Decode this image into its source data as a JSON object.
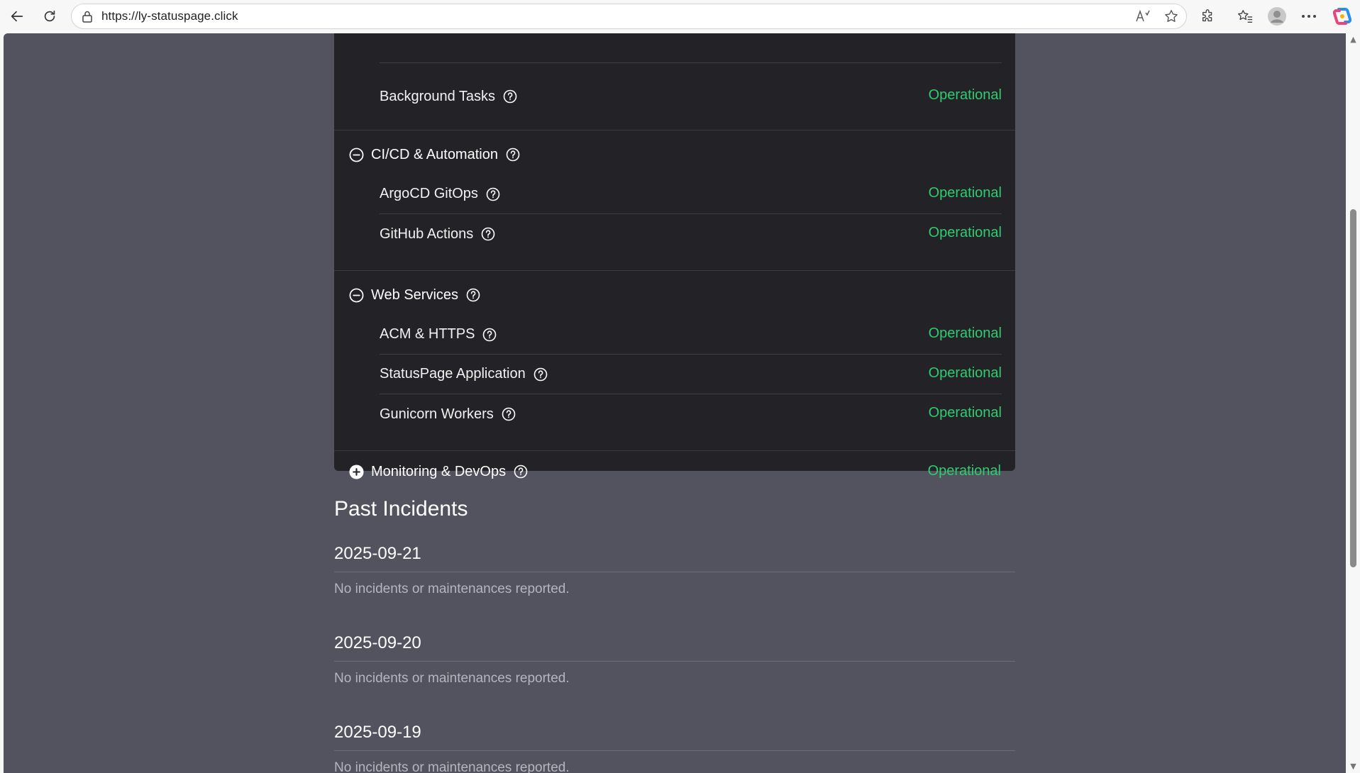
{
  "browser": {
    "url": "https://ly-statuspage.click",
    "icons": [
      "back-icon",
      "refresh-icon",
      "lock-icon",
      "read-aloud-icon",
      "favorite-star-icon",
      "extensions-icon",
      "favorites-icon",
      "profile-icon",
      "more-icon",
      "copilot-icon"
    ]
  },
  "groups": [
    {
      "name": "",
      "expanded": true,
      "components": [
        {
          "name": "Background Tasks",
          "status": "Operational"
        }
      ]
    },
    {
      "name": "CI/CD & Automation",
      "expanded": true,
      "components": [
        {
          "name": "ArgoCD GitOps",
          "status": "Operational"
        },
        {
          "name": "GitHub Actions",
          "status": "Operational"
        }
      ]
    },
    {
      "name": "Web Services",
      "expanded": true,
      "components": [
        {
          "name": "ACM & HTTPS",
          "status": "Operational"
        },
        {
          "name": "StatusPage Application",
          "status": "Operational"
        },
        {
          "name": "Gunicorn Workers",
          "status": "Operational"
        }
      ]
    },
    {
      "name": "Monitoring & DevOps",
      "expanded": false,
      "status": "Operational",
      "components": []
    }
  ],
  "past_incidents": {
    "title": "Past Incidents",
    "days": [
      {
        "date": "2025-09-21",
        "message": "No incidents or maintenances reported."
      },
      {
        "date": "2025-09-20",
        "message": "No incidents or maintenances reported."
      },
      {
        "date": "2025-09-19",
        "message": "No incidents or maintenances reported."
      }
    ]
  },
  "colors": {
    "page_bg": "#52535e",
    "card_bg": "#232327",
    "status_operational": "#2ecc71"
  }
}
